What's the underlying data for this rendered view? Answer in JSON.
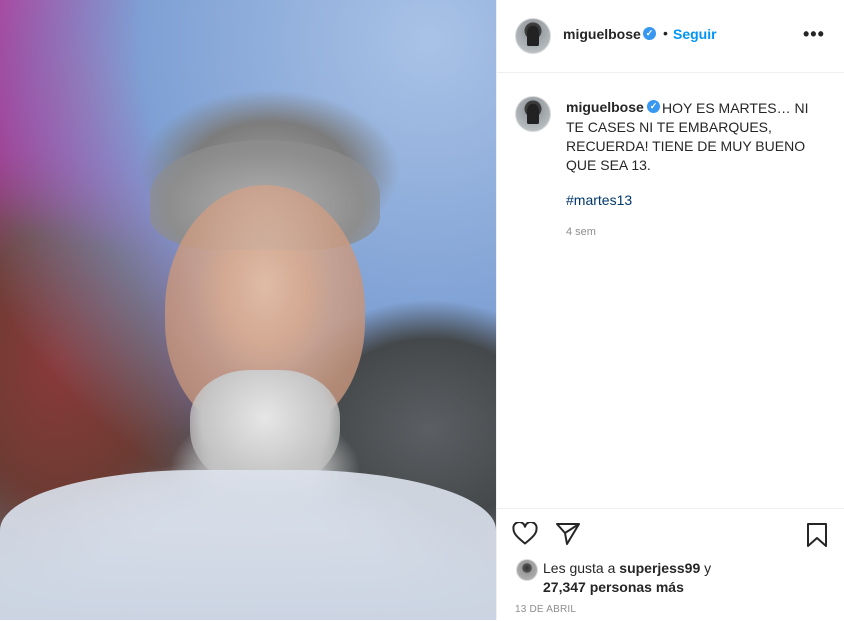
{
  "post": {
    "username": "miguelbose",
    "follow_label": "Seguir",
    "separator": "•",
    "more_label": "•••",
    "caption": "HOY ES MARTES… NI TE CASES NI TE EMBARQUES, RECUERDA! TIENE DE MUY BUENO QUE SEA 13.",
    "hashtag": "#martes13",
    "time_ago": "4 sem",
    "likes_prefix": "Les gusta a",
    "likes_user": "superjess99",
    "likes_joiner": "y",
    "likes_count": "27,347 personas más",
    "date": "13 DE ABRIL"
  },
  "colors": {
    "verified": "#3897f0",
    "follow": "#0095f6",
    "hashtag": "#00376b",
    "muted": "#8e8e8e"
  },
  "icons": {
    "verified": "verified-badge-icon",
    "like": "heart-icon",
    "share": "paper-plane-icon",
    "save": "bookmark-icon",
    "more": "ellipsis-icon"
  }
}
